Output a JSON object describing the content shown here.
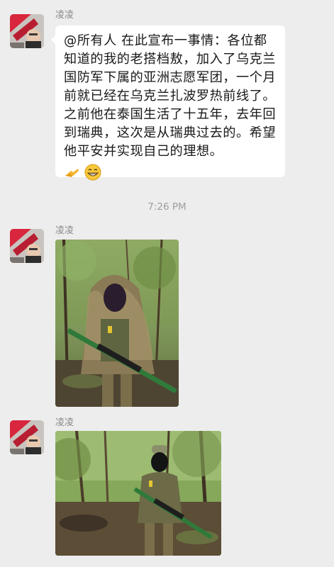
{
  "messages": [
    {
      "sender": "凌凌",
      "type": "text",
      "text": "@所有人 在此宣布一事情：各位都知道的我的老搭档敖，加入了乌克兰国防军下属的亚洲志愿军团，一个月前就已经在乌克兰扎波罗热前线了。之前他在泰国生活了十五年，去年回到瑞典，这次是从瑞典过去的。希望他平安并实现自己的理想。",
      "emojis": [
        "bow-emoji",
        "grin-emoji"
      ]
    },
    {
      "sender": "凌凌",
      "type": "image",
      "description_icon": "photo-soldier-ghillie"
    },
    {
      "sender": "凌凌",
      "type": "image",
      "description_icon": "photo-soldier-forest"
    }
  ],
  "timestamp": "7:26 PM",
  "colors": {
    "background": "#ededed",
    "bubble": "#ffffff",
    "sender_name": "#8c8c8c",
    "timestamp": "#9d9d9d"
  }
}
